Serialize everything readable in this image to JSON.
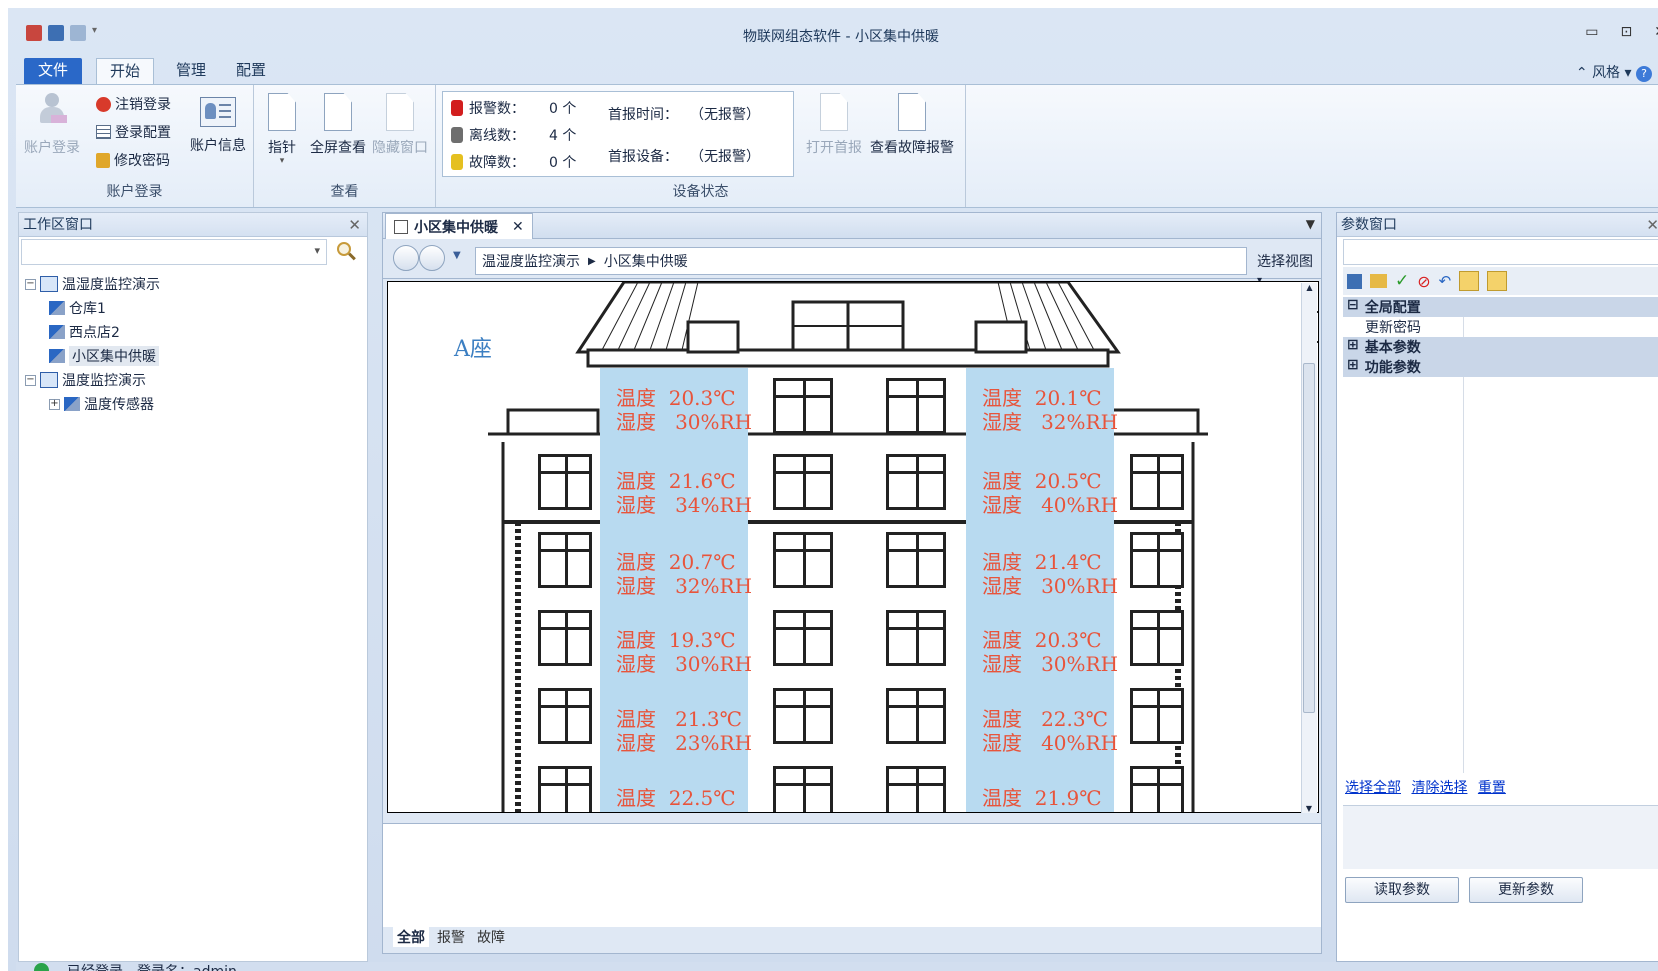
{
  "window": {
    "title": "物联网组态软件 - 小区集中供暖",
    "minimize": "▭",
    "maximize": "⊡",
    "close": "✕"
  },
  "ribbon_tabs": [
    "文件",
    "开始",
    "管理",
    "配置"
  ],
  "style_menu": "风格",
  "groups": {
    "account": {
      "label": "账户登录",
      "login": "账户登录",
      "logout": "注销登录",
      "login_config": "登录配置",
      "change_password": "修改密码",
      "account_info": "账户信息"
    },
    "view": {
      "label": "查看",
      "pointer": "指针",
      "fullscreen": "全屏查看",
      "hide_window": "隐藏窗口"
    },
    "device_status": {
      "label": "设备状态",
      "alarm_label": "报警数：",
      "alarm_value": "0 个",
      "offline_label": "离线数：",
      "offline_value": "4 个",
      "fault_label": "故障数：",
      "fault_value": "0 个",
      "first_time_label": "首报时间：",
      "first_time_value": "（无报警）",
      "first_device_label": "首报设备：",
      "first_device_value": "（无报警）",
      "open_first": "打开首报",
      "view_fault": "查看故障报警"
    }
  },
  "workspace": {
    "title": "工作区窗口",
    "tree": [
      {
        "label": "温湿度监控演示"
      },
      {
        "label": "仓库1"
      },
      {
        "label": "西点店2"
      },
      {
        "label": "小区集中供暖"
      },
      {
        "label": "温度监控演示"
      },
      {
        "label": "温度传感器"
      }
    ]
  },
  "document": {
    "tab_label": "小区集中供暖",
    "breadcrumb_root": "温湿度监控演示",
    "breadcrumb_leaf": "小区集中供暖",
    "select_view": "选择视图",
    "building_label": "A座",
    "left_readings": [
      {
        "temp": "温度  20.3℃",
        "hum": "湿度   30%RH"
      },
      {
        "temp": "温度  21.6℃",
        "hum": "湿度   34%RH"
      },
      {
        "temp": "温度  20.7℃",
        "hum": "湿度   32%RH"
      },
      {
        "temp": "温度  19.3℃",
        "hum": "湿度   30%RH"
      },
      {
        "temp": "温度   21.3℃",
        "hum": "湿度   23%RH"
      },
      {
        "temp": "温度  22.5℃",
        "hum": ""
      }
    ],
    "right_readings": [
      {
        "temp": "温度  20.1℃",
        "hum": "湿度   32%RH"
      },
      {
        "temp": "温度  20.5℃",
        "hum": "湿度   40%RH"
      },
      {
        "temp": "温度  21.4℃",
        "hum": "湿度   30%RH"
      },
      {
        "temp": "温度  20.3℃",
        "hum": "湿度   30%RH"
      },
      {
        "temp": "温度   22.3℃",
        "hum": "湿度   40%RH"
      },
      {
        "temp": "温度  21.9℃",
        "hum": ""
      }
    ],
    "bottom_tabs": [
      "全部",
      "报警",
      "故障"
    ]
  },
  "params": {
    "title": "参数窗口",
    "rows": [
      {
        "label": "全局配置",
        "sign": "⊟"
      },
      {
        "label": "更新密码",
        "sign": ""
      },
      {
        "label": "基本参数",
        "sign": "⊞"
      },
      {
        "label": "功能参数",
        "sign": "⊞"
      }
    ],
    "select_all": "选择全部",
    "clear_selection": "清除选择",
    "reset": "重置",
    "read_button": "读取参数",
    "update_button": "更新参数"
  },
  "statusbar": {
    "text": "已经登录，登录名：admin"
  }
}
